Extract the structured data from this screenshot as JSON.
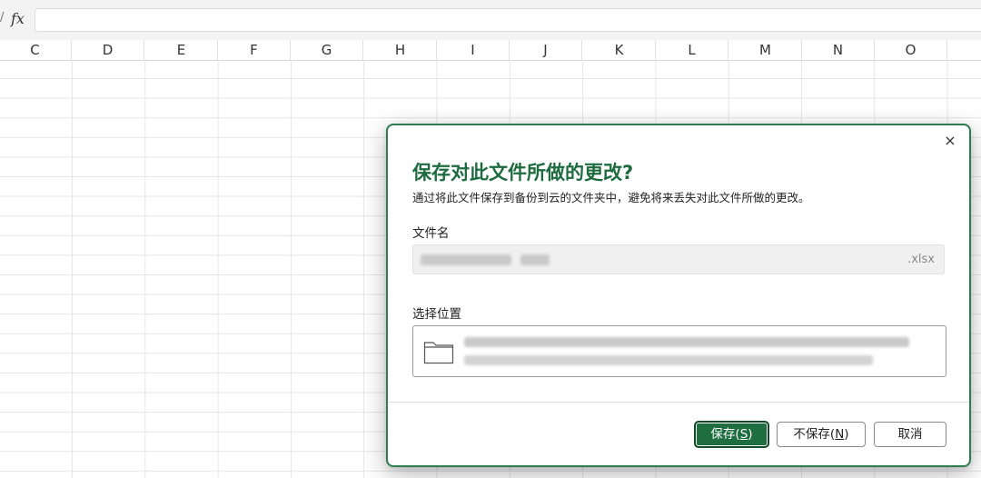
{
  "formula_bar": {
    "fx_label": "fx",
    "separator": "/",
    "value": ""
  },
  "columns": [
    "C",
    "D",
    "E",
    "F",
    "G",
    "H",
    "I",
    "J",
    "K",
    "L",
    "M",
    "N",
    "O"
  ],
  "dialog": {
    "close_icon": "×",
    "title": "保存对此文件所做的更改?",
    "description": "通过将此文件保存到备份到云的文件夹中，避免将来丢失对此文件所做的更改。",
    "filename_label": "文件名",
    "filename_value": "",
    "filename_ext": ".xlsx",
    "location_label": "选择位置",
    "location_icon": "folder-icon",
    "buttons": {
      "save_prefix": "保存(",
      "save_key": "S",
      "save_suffix": ")",
      "nosave_prefix": "不保存(",
      "nosave_key": "N",
      "nosave_suffix": ")",
      "cancel": "取消"
    }
  },
  "colors": {
    "accent": "#1e6e3f",
    "dialog_border": "#2e7d4f",
    "title": "#1d6b3e"
  }
}
